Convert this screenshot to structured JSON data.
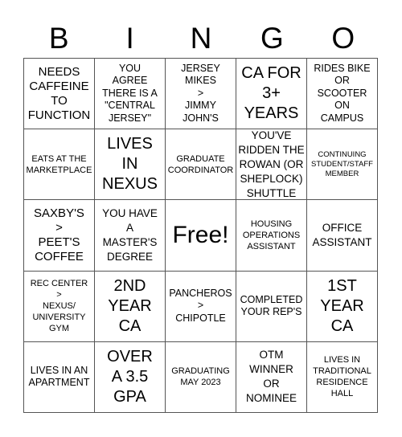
{
  "header": {
    "letters": [
      "B",
      "I",
      "N",
      "G",
      "O"
    ]
  },
  "cells": [
    {
      "text": "NEEDS\nCAFFEINE\nTO\nFUNCTION",
      "size": "s-l"
    },
    {
      "text": "YOU\nAGREE\nTHERE IS A\n\"CENTRAL\nJERSEY\"",
      "size": "s-m"
    },
    {
      "text": "JERSEY\nMIKES\n>\nJIMMY\nJOHN'S",
      "size": "s-m"
    },
    {
      "text": "CA FOR\n3+\nYEARS",
      "size": "s-xl"
    },
    {
      "text": "RIDES BIKE\nOR\nSCOOTER\nON\nCAMPUS",
      "size": "s-m"
    },
    {
      "text": "EATS AT THE\nMARKETPLACE",
      "size": "s-s"
    },
    {
      "text": "LIVES\nIN\nNEXUS",
      "size": "s-xl"
    },
    {
      "text": "GRADUATE\nCOORDINATOR",
      "size": "s-s"
    },
    {
      "text": "YOU'VE\nRIDDEN THE\nROWAN (OR\nSHEPLOCK)\nSHUTTLE",
      "size": "s-ml"
    },
    {
      "text": "CONTINUING\nSTUDENT/STAFF\nMEMBER",
      "size": "s-xs"
    },
    {
      "text": "SAXBY'S\n>\nPEET'S\nCOFFEE",
      "size": "s-l"
    },
    {
      "text": "YOU HAVE\nA\nMASTER'S\nDEGREE",
      "size": "s-ml"
    },
    {
      "text": "Free!",
      "size": "s-free"
    },
    {
      "text": "HOUSING\nOPERATIONS\nASSISTANT",
      "size": "s-s"
    },
    {
      "text": "OFFICE\nASSISTANT",
      "size": "s-ml"
    },
    {
      "text": "REC CENTER\n>\nNEXUS/\nUNIVERSITY\nGYM",
      "size": "s-s"
    },
    {
      "text": "2ND\nYEAR\nCA",
      "size": "s-xl"
    },
    {
      "text": "PANCHEROS\n>\nCHIPOTLE",
      "size": "s-m"
    },
    {
      "text": "COMPLETED\nYOUR REP'S",
      "size": "s-m"
    },
    {
      "text": "1ST\nYEAR\nCA",
      "size": "s-xl"
    },
    {
      "text": "LIVES IN AN\nAPARTMENT",
      "size": "s-m"
    },
    {
      "text": "OVER\nA 3.5\nGPA",
      "size": "s-xl"
    },
    {
      "text": "GRADUATING\nMAY 2023",
      "size": "s-s"
    },
    {
      "text": "OTM\nWINNER\nOR\nNOMINEE",
      "size": "s-ml"
    },
    {
      "text": "LIVES IN\nTRADITIONAL\nRESIDENCE\nHALL",
      "size": "s-s"
    }
  ]
}
